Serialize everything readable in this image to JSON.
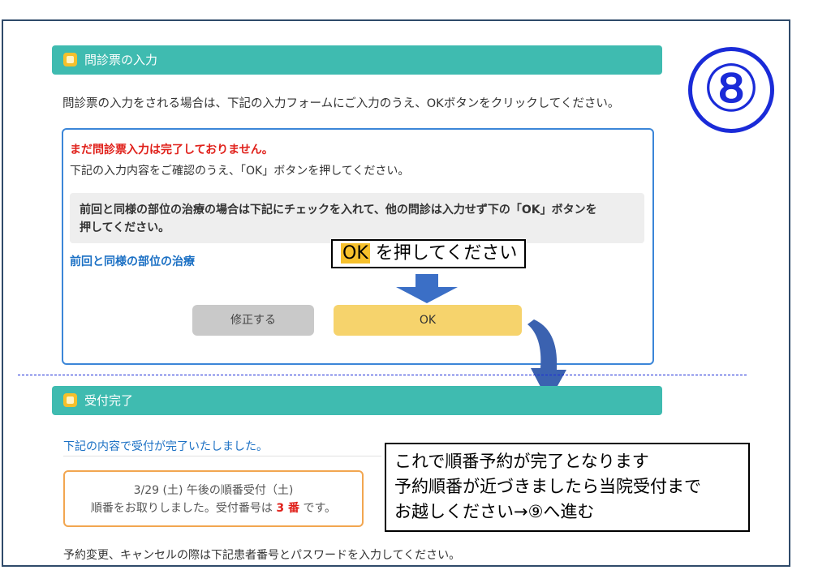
{
  "questionnaire": {
    "header": "問診票の入力",
    "intro": "問診票の入力をされる場合は、下記の入力フォームにご入力のうえ、OKボタンをクリックしてください。",
    "warning": "まだ問診票入力は完了しておりません。",
    "sub": "下記の入力内容をご確認のうえ、「OK」ボタンを押してください。",
    "note_line1": "前回と同様の部位の治療の場合は下記にチェックを入れて、他の問診は入力せず下の「OK」ボタンを",
    "note_line2": "押してください。",
    "same_part_link": "前回と同様の部位の治療",
    "edit_button": "修正する",
    "ok_button": "OK"
  },
  "step_marker": "⑧",
  "callout_ok": {
    "highlight": "OK",
    "rest": "を押してください"
  },
  "reception": {
    "header": "受付完了",
    "done_message": "下記の内容で受付が完了いたしました。",
    "receipt_line1": "3/29 (土) 午後の順番受付（土)",
    "receipt_prefix": "順番をお取りしました。受付番号は",
    "receipt_number": "3 番",
    "receipt_suffix": "です。",
    "footer": "予約変更、キャンセルの際は下記患者番号とパスワードを入力してください。"
  },
  "callout_done": {
    "line1": "これで順番予約が完了となります",
    "line2": "予約順番が近づきましたら当院受付まで",
    "line3": "お越しください→⑨へ進む"
  },
  "colors": {
    "teal_header": "#3fbbb0",
    "card_border": "#3b86d8",
    "ok_button": "#f6d36c",
    "warning_red": "#e0201a",
    "marker_blue": "#1a2bd8"
  }
}
